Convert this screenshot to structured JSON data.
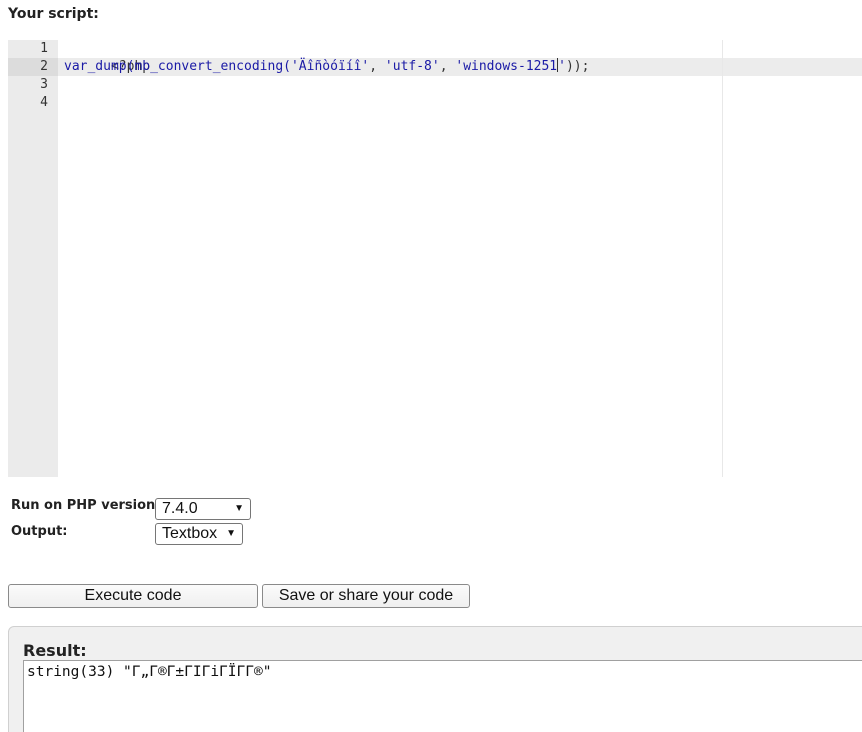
{
  "heading": "Your script:",
  "editor": {
    "line_numbers": [
      "1",
      "2",
      "3",
      "4"
    ],
    "lines": {
      "line1": "<?php",
      "line2_fn": "var_dump(mb_convert_encoding(",
      "line2_arg1": "'Äîñòóïíî'",
      "line2_sep1": ", ",
      "line2_arg2": "'utf-8'",
      "line2_sep2": ", ",
      "line2_arg3_a": "'windows-1251",
      "line2_arg3_b": "'",
      "line2_end": "));"
    }
  },
  "form": {
    "php_version_label": "Run on PHP version:",
    "php_version_value": "7.4.0",
    "output_label": "Output:",
    "output_value": "Textbox",
    "arrow": "▼"
  },
  "buttons": {
    "execute": "Execute code",
    "save": "Save or share your code"
  },
  "result": {
    "label": "Result:",
    "output": "string(33) \"Г„Г®Г±ГІГіГЇГ­Г®\""
  }
}
